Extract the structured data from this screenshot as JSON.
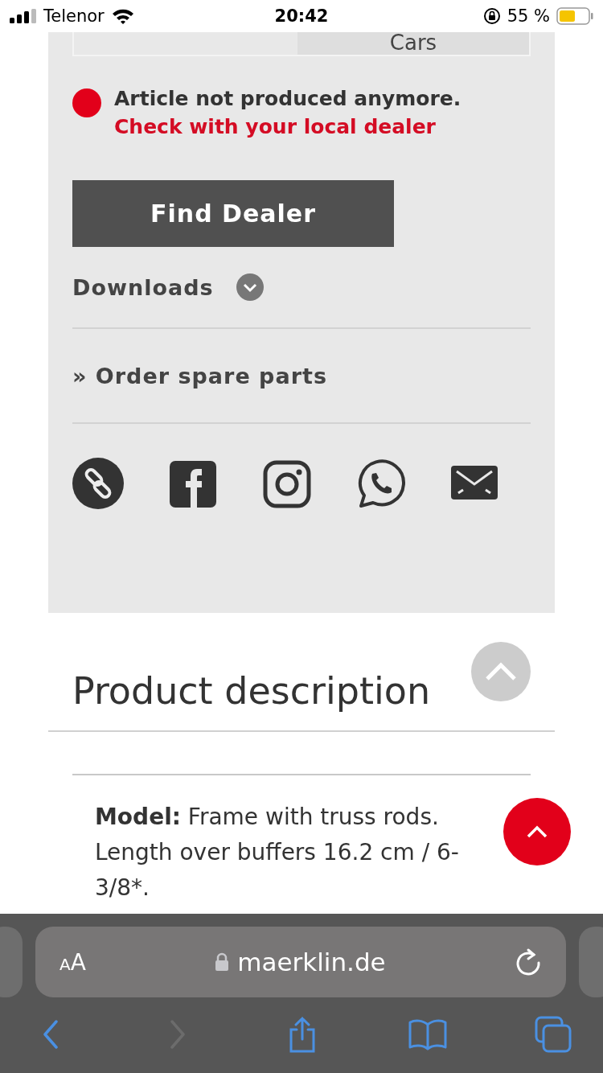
{
  "status_bar": {
    "carrier": "Telenor",
    "time": "20:42",
    "battery": "55 %"
  },
  "details_table": {
    "last_cell": "Cars"
  },
  "availability": {
    "status": "Article not produced anymore.",
    "note": "Check with your local dealer"
  },
  "find_dealer_button": "Find Dealer",
  "downloads": {
    "label": "Downloads",
    "expanded": false
  },
  "spare_parts_link": "» Order spare parts",
  "product_description": {
    "title": "Product description",
    "paragraph": "**Model:** Frame with truss rods. Length over buffers 16.2 cm / 6-3/8*."
  },
  "browser": {
    "text_size_button": "AA",
    "address": "maerklin.de",
    "toolbar": [
      {
        "kind": "back",
        "disabled": false
      },
      {
        "kind": "forward",
        "disabled": true
      },
      {
        "kind": "share",
        "disabled": false
      },
      {
        "kind": "bookmarks",
        "disabled": false
      },
      {
        "kind": "tabs",
        "disabled": false
      }
    ]
  }
}
